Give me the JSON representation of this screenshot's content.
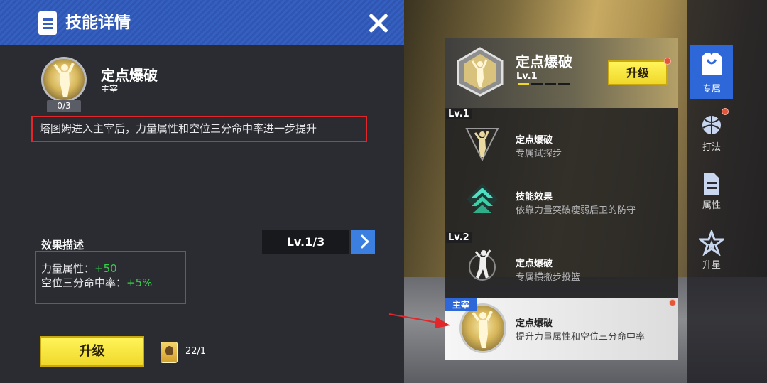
{
  "panel": {
    "title": "技能详情",
    "skill_name": "定点爆破",
    "skill_role": "主宰",
    "progress": "0/3",
    "description": "塔图姆进入主宰后，力量属性和空位三分命中率进一步提升",
    "effect_title": "效果描述",
    "level_label": "Lv.1/3",
    "effects": [
      {
        "label": "力量属性：",
        "value": "+50"
      },
      {
        "label": "空位三分命中率：",
        "value": "+5%"
      }
    ],
    "upgrade_label": "升级",
    "card_count": "22/1"
  },
  "skill_tree": {
    "header": {
      "name": "定点爆破",
      "level": "Lv.1",
      "level_progress": "1 of 5",
      "upgrade_label": "升级"
    },
    "level_tags": [
      "Lv.1",
      "Lv.2"
    ],
    "rows": [
      {
        "title": "定点爆破",
        "subtitle": "专属试探步"
      },
      {
        "title": "技能效果",
        "subtitle": "依靠力量突破瘦弱后卫的防守"
      },
      {
        "title": "定点爆破",
        "subtitle": "专属横撤步投篮"
      }
    ],
    "selected": {
      "tag": "主宰",
      "title": "定点爆破",
      "subtitle": "提升力量属性和空位三分命中率"
    }
  },
  "side_tabs": [
    {
      "label": "专属",
      "icon": "jersey-icon",
      "active": true
    },
    {
      "label": "打法",
      "icon": "tactics-ball-icon",
      "active": false
    },
    {
      "label": "属性",
      "icon": "document-icon",
      "active": false
    },
    {
      "label": "升星",
      "icon": "star-icon",
      "active": false
    }
  ],
  "colors": {
    "header_blue": "#3560c0",
    "accent_blue": "#2e68d8",
    "highlight_red": "#e2262a",
    "value_green": "#36d046",
    "button_yellow": "#f0d82a"
  }
}
